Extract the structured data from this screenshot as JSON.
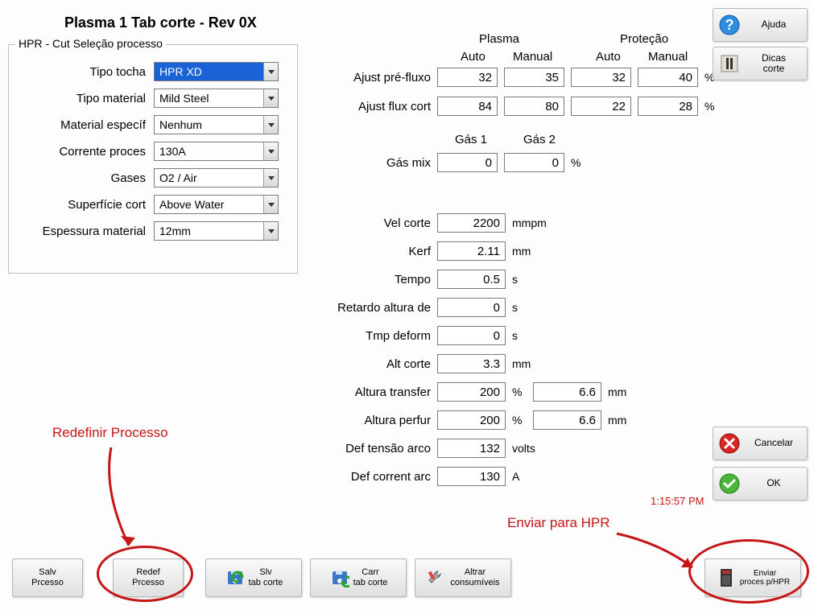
{
  "title": "Plasma 1 Tab corte - Rev 0X",
  "selection": {
    "legend": "HPR - Cut Seleção processo",
    "torch_label": "Tipo tocha",
    "torch_value": "HPR XD",
    "mat_type_label": "Tipo material",
    "mat_type_value": "Mild Steel",
    "mat_spec_label": "Material específ",
    "mat_spec_value": "Nenhum",
    "current_label": "Corrente proces",
    "current_value": "130A",
    "gases_label": "Gases",
    "gases_value": "O2 / Air",
    "surface_label": "Superfície cort",
    "surface_value": "Above Water",
    "thickness_label": "Espessura material",
    "thickness_value": "12mm"
  },
  "headers": {
    "plasma": "Plasma",
    "protecao": "Proteção",
    "auto": "Auto",
    "manual": "Manual"
  },
  "flow": {
    "preflow_label": "Ajust pré-fluxo",
    "preflow": {
      "pa": "32",
      "pm": "35",
      "sa": "32",
      "sm": "40"
    },
    "cutflow_label": "Ajust flux cort",
    "cutflow": {
      "pa": "84",
      "pm": "80",
      "sa": "22",
      "sm": "28"
    },
    "unit_pct": "%"
  },
  "mix": {
    "gas1": "Gás 1",
    "gas2": "Gás 2",
    "mix_label": "Gás mix",
    "v1": "0",
    "v2": "0",
    "unit": "%"
  },
  "params": {
    "vel_label": "Vel corte",
    "vel": "2200",
    "vel_unit": "mmpm",
    "kerf_label": "Kerf",
    "kerf": "2.11",
    "kerf_unit": "mm",
    "tempo_label": "Tempo",
    "tempo": "0.5",
    "tempo_unit": "s",
    "retardo_label": "Retardo altura de",
    "retardo": "0",
    "retardo_unit": "s",
    "deform_label": "Tmp deform",
    "deform": "0",
    "deform_unit": "s",
    "altcorte_label": "Alt corte",
    "altcorte": "3.3",
    "altcorte_unit": "mm",
    "transfer_label": "Altura transfer",
    "transfer_pct": "200",
    "transfer_unit1": "%",
    "transfer_mm": "6.6",
    "transfer_unit2": "mm",
    "perfur_label": "Altura perfur",
    "perfur_pct": "200",
    "perfur_unit1": "%",
    "perfur_mm": "6.6",
    "perfur_unit2": "mm",
    "arcv_label": "Def tensão arco",
    "arcv": "132",
    "arcv_unit": "volts",
    "arci_label": "Def corrent arc",
    "arci": "130",
    "arci_unit": "A"
  },
  "right_buttons": {
    "help": "Ajuda",
    "tips": "Dicas\ncorte",
    "cancel": "Cancelar",
    "ok": "OK"
  },
  "bottom_buttons": {
    "save_proc": "Salv\nPrcesso",
    "redef_proc": "Redef\nPrcesso",
    "save_tab": "Slv\ntab corte",
    "load_tab": "Carr\ntab corte",
    "alter_cons": "Altrar\nconsumíveis",
    "send_hpr": "Enviar\nproces p/HPR"
  },
  "annotations": {
    "redef": "Redefinir Processo",
    "send": "Enviar para HPR"
  },
  "time": "1:15:57 PM"
}
